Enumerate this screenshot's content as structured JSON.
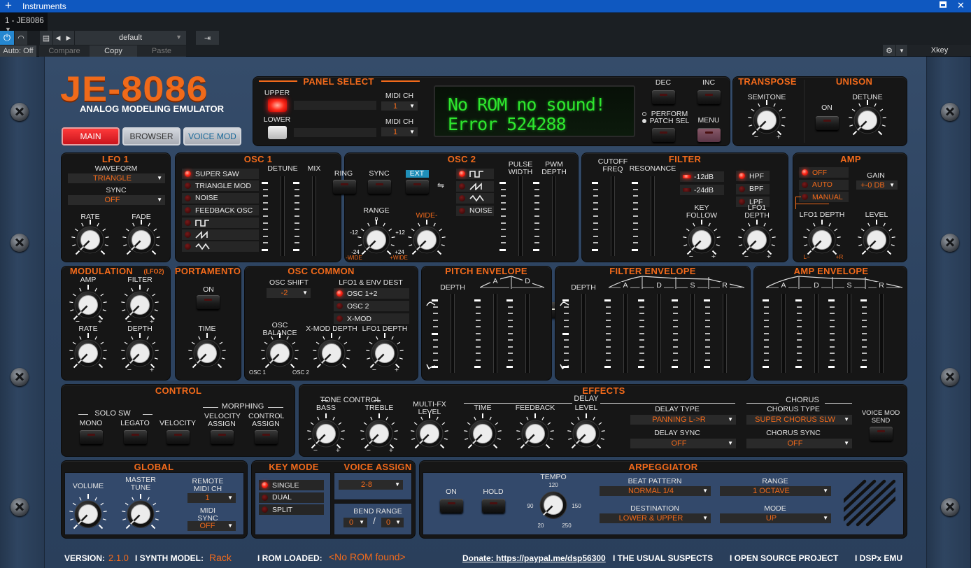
{
  "host": {
    "title": "Instruments",
    "instrument_tab": "1 - JE8086",
    "preset": "default",
    "auto": "Auto: Off",
    "compare": "Compare",
    "copy": "Copy",
    "paste": "Paste",
    "keyboard": "Xkey"
  },
  "header": {
    "logo": "JE-8086",
    "subtitle": "ANALOG MODELING EMULATOR",
    "tabs": [
      {
        "label": "MAIN",
        "active": true
      },
      {
        "label": "BROWSER",
        "active": false
      },
      {
        "label": "VOICE MOD",
        "active": false
      }
    ]
  },
  "panel_select": {
    "title": "PANEL SELECT",
    "upper": "UPPER",
    "lower": "LOWER",
    "midi_ch": "MIDI CH",
    "upper_midi_ch": "1",
    "lower_midi_ch": "1",
    "upper_on": true,
    "lower_on": false
  },
  "lcd": {
    "line1": "No ROM no sound!",
    "line2": "Error 524288"
  },
  "nav": {
    "dec": "DEC",
    "inc": "INC",
    "perform": "PERFORM",
    "patch_sel": "PATCH SEL",
    "menu": "MENU"
  },
  "transpose": {
    "title": "TRANSPOSE",
    "semitone": {
      "label": "SEMITONE",
      "value": 0
    }
  },
  "unison": {
    "title": "UNISON",
    "on": "ON",
    "detune": {
      "label": "DETUNE",
      "value": 0
    }
  },
  "lfo1": {
    "title": "LFO 1",
    "waveform_label": "WAVEFORM",
    "waveform": "TRIANGLE",
    "sync_label": "SYNC",
    "sync": "OFF",
    "rate": {
      "label": "RATE",
      "value": 0
    },
    "fade": {
      "label": "FADE",
      "value": 0
    }
  },
  "osc1": {
    "title": "OSC 1",
    "waves": [
      {
        "label": "SUPER SAW",
        "on": true
      },
      {
        "label": "TRIANGLE MOD",
        "on": false
      },
      {
        "label": "NOISE",
        "on": false
      },
      {
        "label": "FEEDBACK OSC",
        "on": false
      },
      {
        "icon": "square-wave",
        "on": false
      },
      {
        "icon": "saw-wave",
        "on": false
      },
      {
        "icon": "triangle-wave",
        "on": false
      }
    ],
    "detune": {
      "label": "DETUNE",
      "value": 0
    },
    "mix": {
      "label": "MIX",
      "value": 0
    }
  },
  "osc2": {
    "title": "OSC 2",
    "ring": "RING",
    "sync": "SYNC",
    "ext": "EXT",
    "range": {
      "label": "RANGE",
      "value": 0,
      "marks": [
        "0",
        "-12",
        "+12",
        "-24",
        "+24",
        "-WIDE",
        "+WIDE"
      ]
    },
    "wide": {
      "label": "WIDE-",
      "value": 0
    },
    "waves": [
      {
        "icon": "square-wave",
        "on": true
      },
      {
        "icon": "saw-wave",
        "on": false
      },
      {
        "icon": "triangle-wave",
        "on": false
      },
      {
        "label": "NOISE",
        "on": false
      }
    ],
    "pulse_width": {
      "label": "PULSE WIDTH",
      "value": 0
    },
    "pwm_depth": {
      "label": "PWM DEPTH",
      "value": 0
    }
  },
  "filter": {
    "title": "FILTER",
    "cutoff": {
      "label": "CUTOFF FREQ",
      "value": 0
    },
    "resonance": {
      "label": "RESONANCE",
      "value": 0
    },
    "slopes": [
      {
        "label": "-12dB",
        "on": true
      },
      {
        "label": "-24dB",
        "on": false
      }
    ],
    "modes": [
      {
        "label": "HPF",
        "on": true
      },
      {
        "label": "BPF",
        "on": false
      },
      {
        "label": "LPF",
        "on": false
      }
    ],
    "key_follow": {
      "label": "KEY FOLLOW",
      "value": 0
    },
    "lfo1_depth": {
      "label": "LFO1 DEPTH",
      "value": 0
    }
  },
  "amp": {
    "title": "AMP",
    "modes": [
      {
        "label": "OFF",
        "on": true
      },
      {
        "label": "AUTO",
        "on": false
      },
      {
        "label": "MANUAL",
        "on": false
      }
    ],
    "gain_label": "GAIN",
    "gain": "+-0 DB",
    "lfo1_depth": {
      "label": "LFO1 DEPTH",
      "value": 0,
      "min": "L−",
      "max": "+R"
    },
    "level": {
      "label": "LEVEL",
      "value": 0
    }
  },
  "modulation": {
    "title": "MODULATION",
    "subtitle": "(LFO2)",
    "amp": {
      "label": "AMP",
      "value": 0
    },
    "filter": {
      "label": "FILTER",
      "value": 0
    },
    "rate": {
      "label": "RATE",
      "value": 0
    },
    "depth": {
      "label": "DEPTH",
      "value": 0
    }
  },
  "portamento": {
    "title": "PORTAMENTO",
    "on": "ON",
    "time": {
      "label": "TIME",
      "value": 0
    }
  },
  "osc_common": {
    "title": "OSC COMMON",
    "osc_shift_label": "OSC SHIFT",
    "osc_shift": "-2",
    "dest_label": "LFO1 & ENV DEST",
    "dest": [
      {
        "label": "OSC 1+2",
        "on": true
      },
      {
        "label": "OSC 2",
        "on": false
      },
      {
        "label": "X-MOD",
        "on": false
      }
    ],
    "balance": {
      "label": "OSC BALANCE",
      "value": 0,
      "min": "OSC 1",
      "max": "OSC 2"
    },
    "xmod_depth": {
      "label": "X-MOD DEPTH",
      "value": 0
    },
    "lfo1_depth": {
      "label": "LFO1 DEPTH",
      "value": 0
    }
  },
  "pitch_env": {
    "title": "PITCH ENVELOPE",
    "depth": {
      "label": "DEPTH",
      "value": 0
    },
    "a": {
      "label": "A",
      "value": 0
    },
    "d": {
      "label": "D",
      "value": 0
    }
  },
  "filter_env": {
    "title": "FILTER ENVELOPE",
    "depth": {
      "label": "DEPTH",
      "value": 0
    },
    "a": {
      "label": "A",
      "value": 0
    },
    "d": {
      "label": "D",
      "value": 0
    },
    "s": {
      "label": "S",
      "value": 0
    },
    "r": {
      "label": "R",
      "value": 0
    }
  },
  "amp_env": {
    "title": "AMP ENVELOPE",
    "a": {
      "label": "A",
      "value": 0
    },
    "d": {
      "label": "D",
      "value": 0
    },
    "s": {
      "label": "S",
      "value": 0
    },
    "r": {
      "label": "R",
      "value": 0
    }
  },
  "control": {
    "title": "CONTROL",
    "solo_sw": "SOLO SW",
    "morphing": "MORPHING",
    "buttons": [
      "MONO",
      "LEGATO",
      "VELOCITY",
      "VELOCITY ASSIGN",
      "CONTROL ASSIGN"
    ]
  },
  "effects": {
    "title": "EFFECTS",
    "tone_control": "TONE CONTROL",
    "bass": {
      "label": "BASS",
      "value": 0
    },
    "treble": {
      "label": "TREBLE",
      "value": 0
    },
    "multifx_level": {
      "label": "MULTI-FX LEVEL",
      "value": 0
    },
    "delay": "DELAY",
    "delay_time": {
      "label": "TIME",
      "value": 0
    },
    "delay_feedback": {
      "label": "FEEDBACK",
      "value": 0
    },
    "delay_level": {
      "label": "LEVEL",
      "value": 0
    },
    "delay_type_label": "DELAY TYPE",
    "delay_type": "PANNING L->R",
    "delay_sync_label": "DELAY SYNC",
    "delay_sync": "OFF",
    "chorus": "CHORUS",
    "chorus_type_label": "CHORUS TYPE",
    "chorus_type": "SUPER CHORUS SLW",
    "chorus_sync_label": "CHORUS SYNC",
    "chorus_sync": "OFF",
    "voice_mod_send": "VOICE MOD SEND"
  },
  "global": {
    "title": "GLOBAL",
    "volume": {
      "label": "VOLUME",
      "value": 0
    },
    "master_tune": {
      "label": "MASTER TUNE",
      "value": 0
    },
    "remote_midi_ch_label": "REMOTE MIDI CH",
    "remote_midi_ch": "1",
    "midi_sync_label": "MIDI SYNC",
    "midi_sync": "OFF"
  },
  "key_mode": {
    "title": "KEY MODE",
    "modes": [
      {
        "label": "SINGLE",
        "on": true
      },
      {
        "label": "DUAL",
        "on": false
      },
      {
        "label": "SPLIT",
        "on": false
      }
    ]
  },
  "voice_assign": {
    "title": "VOICE ASSIGN",
    "value": "2-8",
    "bend_range_label": "BEND RANGE",
    "bend_down": "0",
    "separator": "/",
    "bend_up": "0"
  },
  "arpeggiator": {
    "title": "ARPEGGIATOR",
    "on": "ON",
    "hold": "HOLD",
    "tempo": {
      "label": "TEMPO",
      "value": 0,
      "marks": [
        "120",
        "90",
        "150",
        "20",
        "250"
      ]
    },
    "beat_pattern_label": "BEAT PATTERN",
    "beat_pattern": "NORMAL 1/4",
    "range_label": "RANGE",
    "range": "1 OCTAVE",
    "destination_label": "DESTINATION",
    "destination": "LOWER & UPPER",
    "mode_label": "MODE",
    "mode": "UP"
  },
  "footer": {
    "version_label": "VERSION:",
    "version": "2.1.0",
    "model_label": "I SYNTH MODEL:",
    "model": "Rack",
    "rom_label": "I ROM LOADED:",
    "rom": "<No ROM found>",
    "donate": "Donate: https://paypal.me/dsp56300",
    "credits": [
      "I THE USUAL SUSPECTS",
      "I OPEN SOURCE PROJECT",
      "I DSPx EMU"
    ]
  },
  "common": {
    "minus": "−",
    "plus": "+"
  },
  "colors": {
    "accent": "#f26a1b",
    "panel": "#161616",
    "background": "#2f4562",
    "led_on": "#ff2a1a",
    "host_blue": "#0f58c0",
    "lcd_text": "#2ee62e"
  }
}
